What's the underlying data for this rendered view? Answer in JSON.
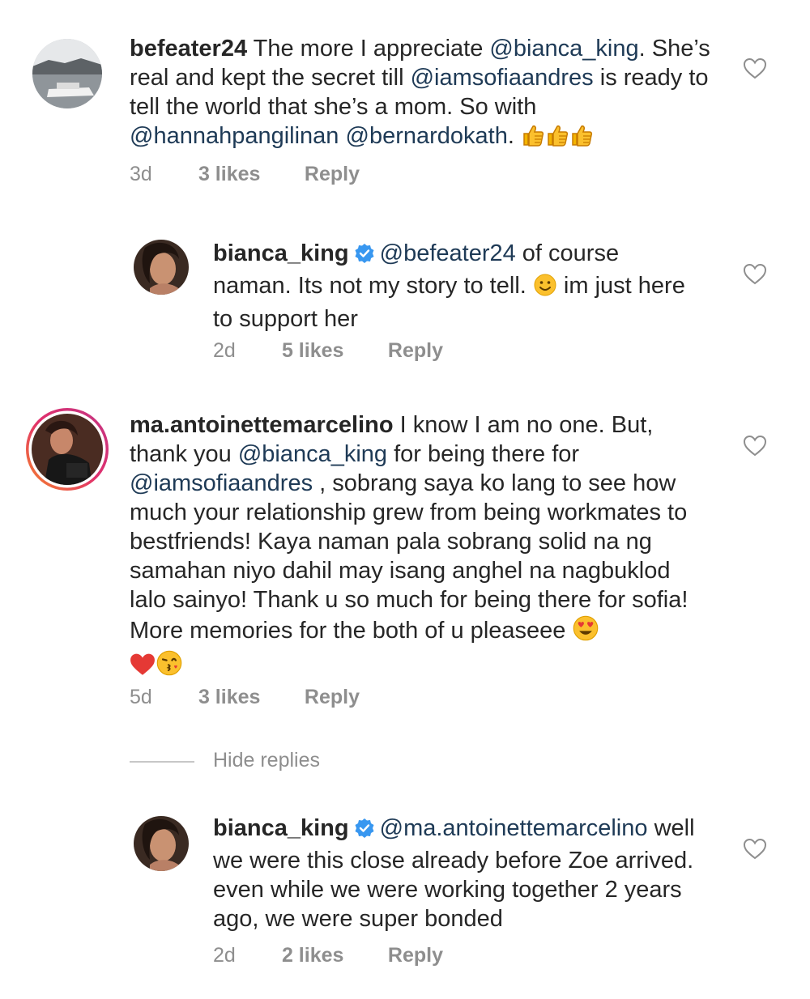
{
  "comments": [
    {
      "username": "befeater24",
      "segments": [
        {
          "t": " The more I appreciate "
        },
        {
          "m": "@bianca_king"
        },
        {
          "t": ". She’s real and kept the secret till "
        },
        {
          "m": "@iamsofiaandres"
        },
        {
          "t": " is ready to tell the world that she’s a mom. So with "
        },
        {
          "m": "@hannahpangilinan"
        },
        {
          "t": " "
        },
        {
          "m": "@bernardokath"
        },
        {
          "t": ". "
        }
      ],
      "emoji": [
        "thumbs-up",
        "thumbs-up",
        "thumbs-up"
      ],
      "time": "3d",
      "likes": "3 likes",
      "reply": "Reply"
    },
    {
      "username": "bianca_king",
      "segments": [
        {
          "m": "@befeater24"
        },
        {
          "t": " of course naman.  Its not my story to tell. "
        },
        {
          "e": "smile"
        },
        {
          "t": " im just here to support her"
        }
      ],
      "time": "2d",
      "likes": "5 likes",
      "reply": "Reply"
    },
    {
      "username": "ma.antoinettemarcelino",
      "segments": [
        {
          "t": " I know I am no one. But, thank you "
        },
        {
          "m": "@bianca_king"
        },
        {
          "t": "  for being there for "
        },
        {
          "m": "@iamsofiaandres"
        },
        {
          "t": " , sobrang saya ko lang to see how much your relationship grew from being workmates to bestfriends! Kaya naman pala sobrang solid na ng samahan niyo dahil may isang anghel na nagbuklod lalo sainyo! Thank u so much for being there for sofia! More memories for the both of u pleaseee "
        }
      ],
      "emoji": [
        "heart-eyes",
        "red-heart",
        "kiss"
      ],
      "time": "5d",
      "likes": "3 likes",
      "reply": "Reply"
    },
    {
      "username": "bianca_king",
      "segments": [
        {
          "m": "@ma.antoinettemarcelino"
        },
        {
          "t": " well we were this close already before Zoe arrived. even while we were working together 2 years ago, we were super bonded"
        }
      ],
      "time": "2d",
      "likes": "2 likes",
      "reply": "Reply"
    }
  ],
  "hide_replies": "Hide replies",
  "icons": {
    "like": "heart-outline-icon",
    "verified": "verified-badge-icon"
  },
  "colors": {
    "mention": "#1e3a56",
    "meta": "#8e8e8e",
    "verified": "#3897f0",
    "story_ring_start": "#c13584",
    "story_ring_end": "#f58529"
  }
}
